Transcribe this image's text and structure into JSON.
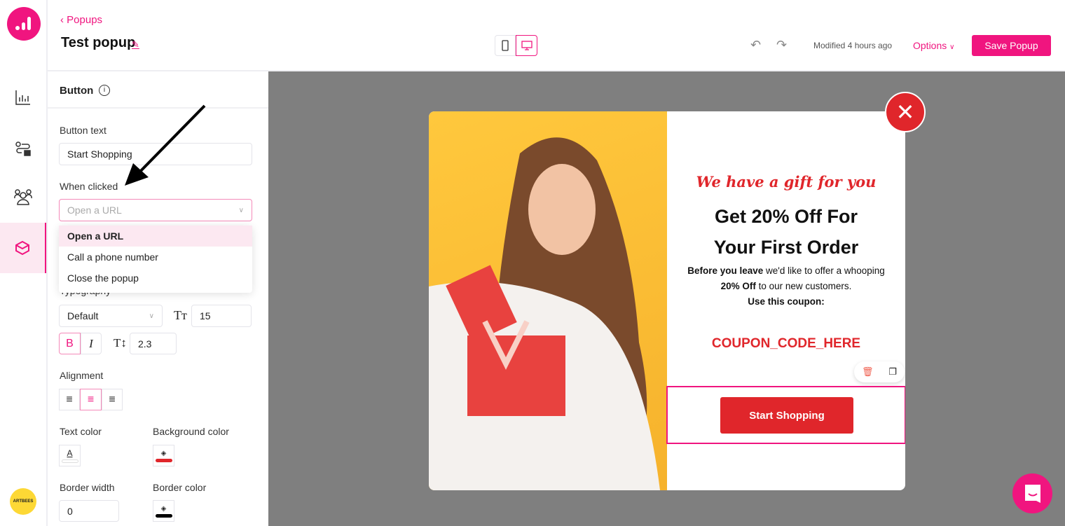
{
  "header": {
    "back_label": "Popups",
    "title": "Test popup",
    "modified": "Modified 4 hours ago",
    "options_label": "Options",
    "save_label": "Save Popup"
  },
  "panel": {
    "section_title": "Button",
    "button_text_label": "Button text",
    "button_text_value": "Start Shopping",
    "when_clicked_label": "When clicked",
    "when_clicked_value": "Open a URL",
    "when_clicked_options": [
      "Open a URL",
      "Call a phone number",
      "Close the popup"
    ],
    "typography_label": "Typography",
    "font_value": "Default",
    "font_size": "15",
    "line_height": "2.3",
    "bold_label": "B",
    "italic_label": "I",
    "alignment_label": "Alignment",
    "alignment_selected": "center",
    "text_color_label": "Text color",
    "text_color_glyph": "A",
    "background_color_label": "Background color",
    "border_width_label": "Border width",
    "border_width_value": "0",
    "border_color_label": "Border color",
    "background_color": "#e0262b",
    "border_color": "#000000",
    "text_color": "#ffffff"
  },
  "brand": {
    "artbees_text": "ARTBEES",
    "accent": "#f0157f"
  },
  "popup": {
    "tagline": "We have a gift for you",
    "headline_1": "Get 20% Off For",
    "headline_2": "Your First Order",
    "body_bold_1": "Before you leave",
    "body_1": " we'd like to offer a whooping",
    "body_bold_2": "20% Off",
    "body_2": " to our new customers.",
    "body_3": "Use this coupon:",
    "coupon": "COUPON_CODE_HERE",
    "button_label": "Start Shopping",
    "close_glyph": "✕"
  }
}
